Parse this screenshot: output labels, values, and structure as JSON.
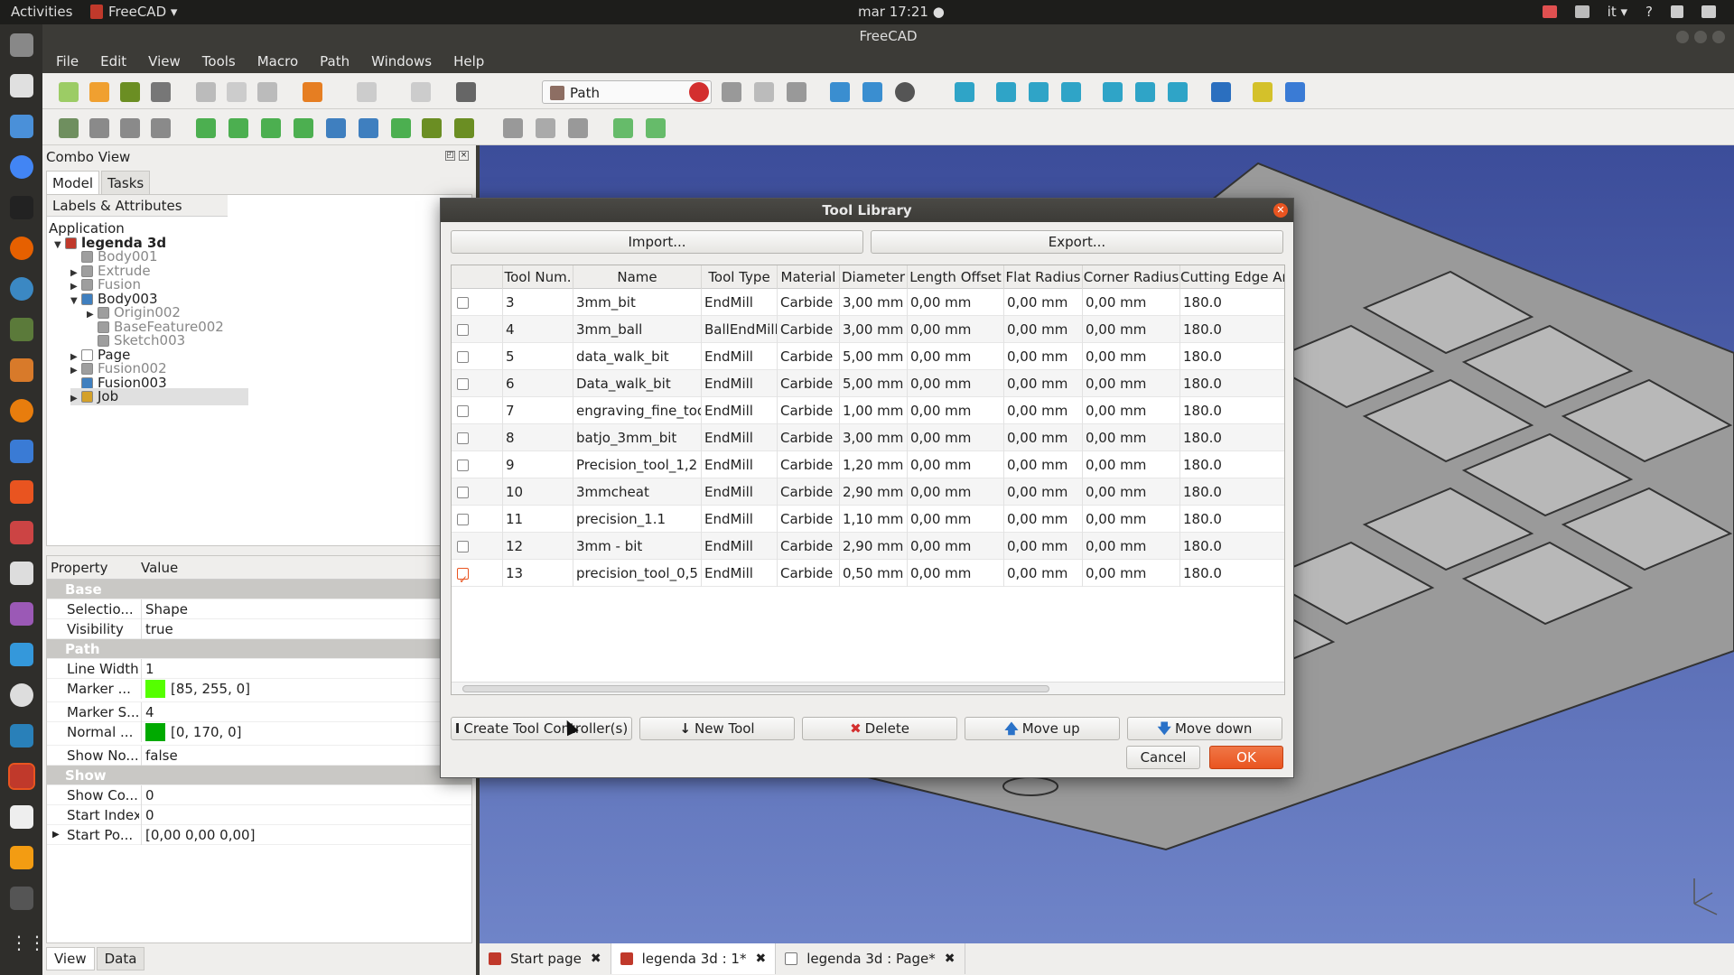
{
  "topbar": {
    "activities": "Activities",
    "app_name": "FreeCAD ▾",
    "clock": "mar 17:21 ●",
    "lang": "it ▾",
    "help": "?"
  },
  "window": {
    "title": "FreeCAD"
  },
  "menu": [
    "File",
    "Edit",
    "View",
    "Tools",
    "Macro",
    "Path",
    "Windows",
    "Help"
  ],
  "workbench": {
    "selected": "Path"
  },
  "combo_view": {
    "title": "Combo View",
    "tabs": [
      "Model",
      "Tasks"
    ],
    "tree_header": "Labels & Attributes",
    "tree": [
      {
        "label": "Application",
        "indent": 0,
        "style": "normal",
        "arrow": ""
      },
      {
        "label": "legenda 3d",
        "indent": 1,
        "style": "bold",
        "arrow": "▼"
      },
      {
        "label": "Body001",
        "indent": 2,
        "style": "grey",
        "arrow": ""
      },
      {
        "label": "Extrude",
        "indent": 2,
        "style": "grey",
        "arrow": "▶"
      },
      {
        "label": "Fusion",
        "indent": 2,
        "style": "grey",
        "arrow": "▶"
      },
      {
        "label": "Body003",
        "indent": 2,
        "style": "normal",
        "arrow": "▼"
      },
      {
        "label": "Origin002",
        "indent": 3,
        "style": "grey",
        "arrow": "▶"
      },
      {
        "label": "BaseFeature002",
        "indent": 3,
        "style": "grey",
        "arrow": ""
      },
      {
        "label": "Sketch003",
        "indent": 3,
        "style": "grey",
        "arrow": ""
      },
      {
        "label": "Page",
        "indent": 2,
        "style": "normal",
        "arrow": "▶"
      },
      {
        "label": "Fusion002",
        "indent": 2,
        "style": "grey",
        "arrow": "▶"
      },
      {
        "label": "Fusion003",
        "indent": 2,
        "style": "normal",
        "arrow": ""
      },
      {
        "label": "Job",
        "indent": 2,
        "style": "normal",
        "arrow": "▶"
      }
    ],
    "props_header": {
      "property": "Property",
      "value": "Value"
    },
    "props": {
      "base_group": "Base",
      "selection_name": "Selectio...",
      "selection_value": "Shape",
      "visibility_name": "Visibility",
      "visibility_value": "true",
      "path_group": "Path",
      "linewidth_name": "Line Width",
      "linewidth_value": "1",
      "marker_name": "Marker ...",
      "marker_value": "[85, 255, 0]",
      "markersize_name": "Marker S...",
      "markersize_value": "4",
      "normal_name": "Normal ...",
      "normal_value": "[0, 170, 0]",
      "shownormal_name": "Show No...",
      "shownormal_value": "false",
      "show_group": "Show",
      "showcount_name": "Show Co...",
      "showcount_value": "0",
      "startindex_name": "Start Index",
      "startindex_value": "0",
      "startpos_name": "Start Po...",
      "startpos_value": "[0,00 0,00 0,00]"
    },
    "bottom_tabs": [
      "View",
      "Data"
    ]
  },
  "colors": {
    "marker": "#55ff00",
    "normal": "#00aa00",
    "accent": "#e95420"
  },
  "doc_tabs": [
    "Start page",
    "legenda 3d : 1*",
    "legenda 3d : Page*"
  ],
  "dialog": {
    "title": "Tool Library",
    "import": "Import...",
    "export": "Export...",
    "columns": [
      "",
      "Tool Num.",
      "Name",
      "Tool Type",
      "Material",
      "Diameter",
      "Length Offset",
      "Flat Radius",
      "Corner Radius",
      "Cutting Edge An"
    ],
    "rows": [
      {
        "checked": false,
        "num": "3",
        "name": "3mm_bit",
        "type": "EndMill",
        "material": "Carbide",
        "diameter": "3,00 mm",
        "length": "0,00 mm",
        "flat": "0,00 mm",
        "corner": "0,00 mm",
        "angle": "180.0"
      },
      {
        "checked": false,
        "num": "4",
        "name": "3mm_ball",
        "type": "BallEndMill",
        "material": "Carbide",
        "diameter": "3,00 mm",
        "length": "0,00 mm",
        "flat": "0,00 mm",
        "corner": "0,00 mm",
        "angle": "180.0"
      },
      {
        "checked": false,
        "num": "5",
        "name": "data_walk_bit",
        "type": "EndMill",
        "material": "Carbide",
        "diameter": "5,00 mm",
        "length": "0,00 mm",
        "flat": "0,00 mm",
        "corner": "0,00 mm",
        "angle": "180.0"
      },
      {
        "checked": false,
        "num": "6",
        "name": "Data_walk_bit",
        "type": "EndMill",
        "material": "Carbide",
        "diameter": "5,00 mm",
        "length": "0,00 mm",
        "flat": "0,00 mm",
        "corner": "0,00 mm",
        "angle": "180.0"
      },
      {
        "checked": false,
        "num": "7",
        "name": "engraving_fine_tool",
        "type": "EndMill",
        "material": "Carbide",
        "diameter": "1,00 mm",
        "length": "0,00 mm",
        "flat": "0,00 mm",
        "corner": "0,00 mm",
        "angle": "180.0"
      },
      {
        "checked": false,
        "num": "8",
        "name": "batjo_3mm_bit",
        "type": "EndMill",
        "material": "Carbide",
        "diameter": "3,00 mm",
        "length": "0,00 mm",
        "flat": "0,00 mm",
        "corner": "0,00 mm",
        "angle": "180.0"
      },
      {
        "checked": false,
        "num": "9",
        "name": "Precision_tool_1,2",
        "type": "EndMill",
        "material": "Carbide",
        "diameter": "1,20 mm",
        "length": "0,00 mm",
        "flat": "0,00 mm",
        "corner": "0,00 mm",
        "angle": "180.0"
      },
      {
        "checked": false,
        "num": "10",
        "name": "3mmcheat",
        "type": "EndMill",
        "material": "Carbide",
        "diameter": "2,90 mm",
        "length": "0,00 mm",
        "flat": "0,00 mm",
        "corner": "0,00 mm",
        "angle": "180.0"
      },
      {
        "checked": false,
        "num": "11",
        "name": "precision_1.1",
        "type": "EndMill",
        "material": "Carbide",
        "diameter": "1,10 mm",
        "length": "0,00 mm",
        "flat": "0,00 mm",
        "corner": "0,00 mm",
        "angle": "180.0"
      },
      {
        "checked": false,
        "num": "12",
        "name": "3mm - bit",
        "type": "EndMill",
        "material": "Carbide",
        "diameter": "2,90 mm",
        "length": "0,00 mm",
        "flat": "0,00 mm",
        "corner": "0,00 mm",
        "angle": "180.0"
      },
      {
        "checked": true,
        "num": "13",
        "name": "precision_tool_0,5",
        "type": "EndMill",
        "material": "Carbide",
        "diameter": "0,50 mm",
        "length": "0,00 mm",
        "flat": "0,00 mm",
        "corner": "0,00 mm",
        "angle": "180.0"
      }
    ],
    "buttons": {
      "create_controller": "Create Tool Controller(s)",
      "new_tool": "New Tool",
      "delete": "Delete",
      "move_up": "Move up",
      "move_down": "Move down",
      "cancel": "Cancel",
      "ok": "OK"
    }
  }
}
